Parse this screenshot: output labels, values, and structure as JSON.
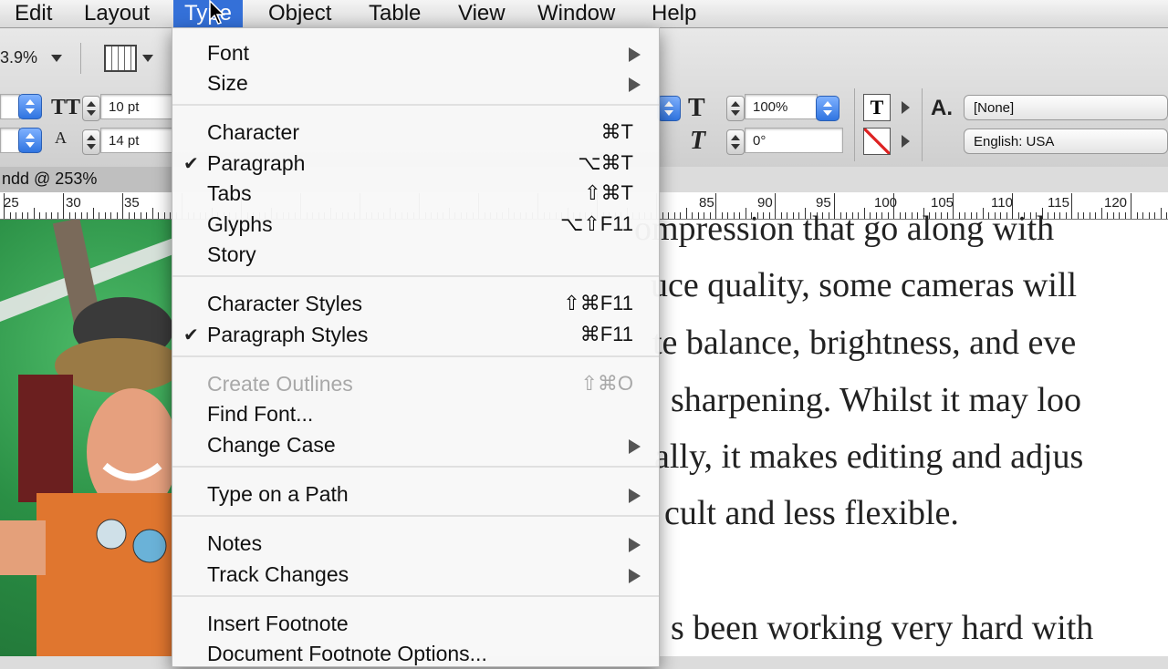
{
  "menubar": {
    "items": [
      "Edit",
      "Layout",
      "Type",
      "Object",
      "Table",
      "View",
      "Window",
      "Help"
    ],
    "active": "Type"
  },
  "controlbar": {
    "zoom": "3.9%",
    "font_size": "10 pt",
    "leading": "14 pt",
    "scale": "100%",
    "skew": "0°",
    "char_style": "[None]",
    "language": "English: USA"
  },
  "doc_tab": "ndd @ 253%",
  "ruler": [
    "25",
    "30",
    "35",
    "85",
    "90",
    "95",
    "100",
    "105",
    "110",
    "115",
    "120"
  ],
  "document": {
    "lines": [
      "ompression that go along with",
      "uce quality, some cameras will",
      "te balance, brightness, and eve",
      "sharpening. Whilst it may loo",
      "ally, it makes editing and adjus",
      "cult and less flexible.",
      "s been working very hard with"
    ]
  },
  "menu": {
    "items": [
      {
        "label": "Font",
        "shortcut": "",
        "submenu": true,
        "checked": false,
        "disabled": false
      },
      {
        "label": "Size",
        "shortcut": "",
        "submenu": true,
        "checked": false,
        "disabled": false
      },
      {
        "label": "Character",
        "shortcut": "⌘T",
        "submenu": false,
        "checked": false,
        "disabled": false
      },
      {
        "label": "Paragraph",
        "shortcut": "⌥⌘T",
        "submenu": false,
        "checked": true,
        "disabled": false
      },
      {
        "label": "Tabs",
        "shortcut": "⇧⌘T",
        "submenu": false,
        "checked": false,
        "disabled": false
      },
      {
        "label": "Glyphs",
        "shortcut": "⌥⇧F11",
        "submenu": false,
        "checked": false,
        "disabled": false
      },
      {
        "label": "Story",
        "shortcut": "",
        "submenu": false,
        "checked": false,
        "disabled": false
      },
      {
        "label": "Character Styles",
        "shortcut": "⇧⌘F11",
        "submenu": false,
        "checked": false,
        "disabled": false
      },
      {
        "label": "Paragraph Styles",
        "shortcut": "⌘F11",
        "submenu": false,
        "checked": true,
        "disabled": false
      },
      {
        "label": "Create Outlines",
        "shortcut": "⇧⌘O",
        "submenu": false,
        "checked": false,
        "disabled": true
      },
      {
        "label": "Find Font...",
        "shortcut": "",
        "submenu": false,
        "checked": false,
        "disabled": false
      },
      {
        "label": "Change Case",
        "shortcut": "",
        "submenu": true,
        "checked": false,
        "disabled": false
      },
      {
        "label": "Type on a Path",
        "shortcut": "",
        "submenu": true,
        "checked": false,
        "disabled": false
      },
      {
        "label": "Notes",
        "shortcut": "",
        "submenu": true,
        "checked": false,
        "disabled": false
      },
      {
        "label": "Track Changes",
        "shortcut": "",
        "submenu": true,
        "checked": false,
        "disabled": false
      },
      {
        "label": "Insert Footnote",
        "shortcut": "",
        "submenu": false,
        "checked": false,
        "disabled": false
      },
      {
        "label": "Document Footnote Options...",
        "shortcut": "",
        "submenu": false,
        "checked": false,
        "disabled": false
      }
    ]
  },
  "check_glyph": "✔",
  "colors": {
    "menu_highlight": "#3470d8"
  }
}
